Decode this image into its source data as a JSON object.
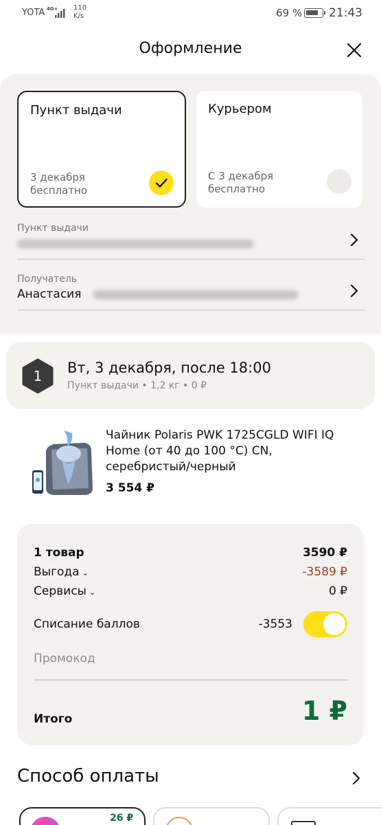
{
  "status_bar": {
    "carrier": "YOTA",
    "network": "4G+",
    "speed_value": "110",
    "speed_unit": "K/s",
    "battery": "69 %",
    "time": "21:43"
  },
  "header": {
    "title": "Оформление"
  },
  "delivery_options": {
    "pickup": {
      "title": "Пункт выдачи",
      "date": "3 декабря",
      "price": "бесплатно",
      "selected": true
    },
    "courier": {
      "title": "Курьером",
      "date": "С 3 декабря",
      "price": "бесплатно",
      "selected": false
    }
  },
  "pickup_point": {
    "label": "Пункт выдачи"
  },
  "recipient": {
    "label": "Получатель",
    "name": "Анастасия"
  },
  "shipment": {
    "number": "1",
    "title": "Вт, 3 декабря, после 18:00",
    "subtitle": "Пункт выдачи • 1,2 кг • 0 ₽"
  },
  "product": {
    "name": "Чайник Polaris PWK 1725CGLD WIFI IQ Home (от 40 до 100 °С) CN, серебристый/черный",
    "price": "3 554 ₽"
  },
  "summary": {
    "items_label": "1 товар",
    "items_value": "3590 ₽",
    "benefit_label": "Выгода",
    "benefit_value": "-3589 ₽",
    "services_label": "Сервисы",
    "services_value": "0 ₽",
    "points_label": "Списание баллов",
    "points_value": "-3553",
    "points_enabled": true,
    "promo_placeholder": "Промокод",
    "total_label": "Итого",
    "total_value": "1 ₽"
  },
  "payment": {
    "title": "Способ оплаты",
    "bonus_partial": "26 ₽"
  },
  "colors": {
    "accent_yellow": "#ffde1a",
    "total_green": "#0f6b3d",
    "discount_red": "#a33a2a",
    "section_bg": "#f3f2ef"
  }
}
